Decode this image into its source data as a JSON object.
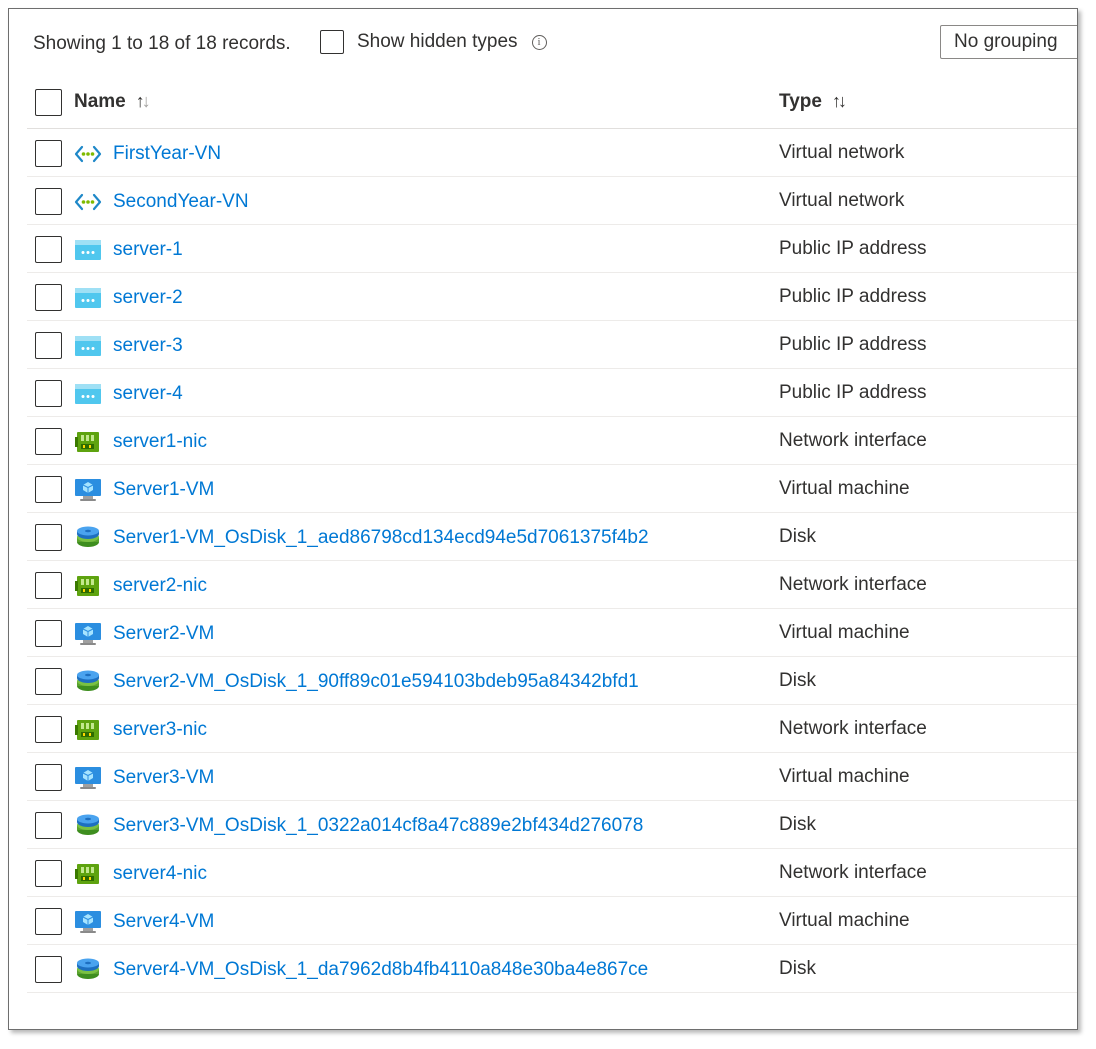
{
  "toolbar": {
    "records_text": "Showing 1 to 18 of 18 records.",
    "show_hidden_label": "Show hidden types",
    "info_glyph": "i",
    "grouping_value": "No grouping"
  },
  "columns": {
    "name": "Name",
    "type": "Type"
  },
  "rows": [
    {
      "name": "FirstYear-VN",
      "type": "Virtual network",
      "icon": "virtual-network-icon"
    },
    {
      "name": "SecondYear-VN",
      "type": "Virtual network",
      "icon": "virtual-network-icon"
    },
    {
      "name": "server-1",
      "type": "Public IP address",
      "icon": "public-ip-icon"
    },
    {
      "name": "server-2",
      "type": "Public IP address",
      "icon": "public-ip-icon"
    },
    {
      "name": "server-3",
      "type": "Public IP address",
      "icon": "public-ip-icon"
    },
    {
      "name": "server-4",
      "type": "Public IP address",
      "icon": "public-ip-icon"
    },
    {
      "name": "server1-nic",
      "type": "Network interface",
      "icon": "network-interface-icon"
    },
    {
      "name": "Server1-VM",
      "type": "Virtual machine",
      "icon": "virtual-machine-icon"
    },
    {
      "name": "Server1-VM_OsDisk_1_aed86798cd134ecd94e5d7061375f4b2",
      "type": "Disk",
      "icon": "disk-icon"
    },
    {
      "name": "server2-nic",
      "type": "Network interface",
      "icon": "network-interface-icon"
    },
    {
      "name": "Server2-VM",
      "type": "Virtual machine",
      "icon": "virtual-machine-icon"
    },
    {
      "name": "Server2-VM_OsDisk_1_90ff89c01e594103bdeb95a84342bfd1",
      "type": "Disk",
      "icon": "disk-icon"
    },
    {
      "name": "server3-nic",
      "type": "Network interface",
      "icon": "network-interface-icon"
    },
    {
      "name": "Server3-VM",
      "type": "Virtual machine",
      "icon": "virtual-machine-icon"
    },
    {
      "name": "Server3-VM_OsDisk_1_0322a014cf8a47c889e2bf434d276078",
      "type": "Disk",
      "icon": "disk-icon"
    },
    {
      "name": "server4-nic",
      "type": "Network interface",
      "icon": "network-interface-icon"
    },
    {
      "name": "Server4-VM",
      "type": "Virtual machine",
      "icon": "virtual-machine-icon"
    },
    {
      "name": "Server4-VM_OsDisk_1_da7962d8b4fb4110a848e30ba4e867ce",
      "type": "Disk",
      "icon": "disk-icon"
    }
  ],
  "colors": {
    "link": "#0078d4",
    "text": "#323130"
  }
}
